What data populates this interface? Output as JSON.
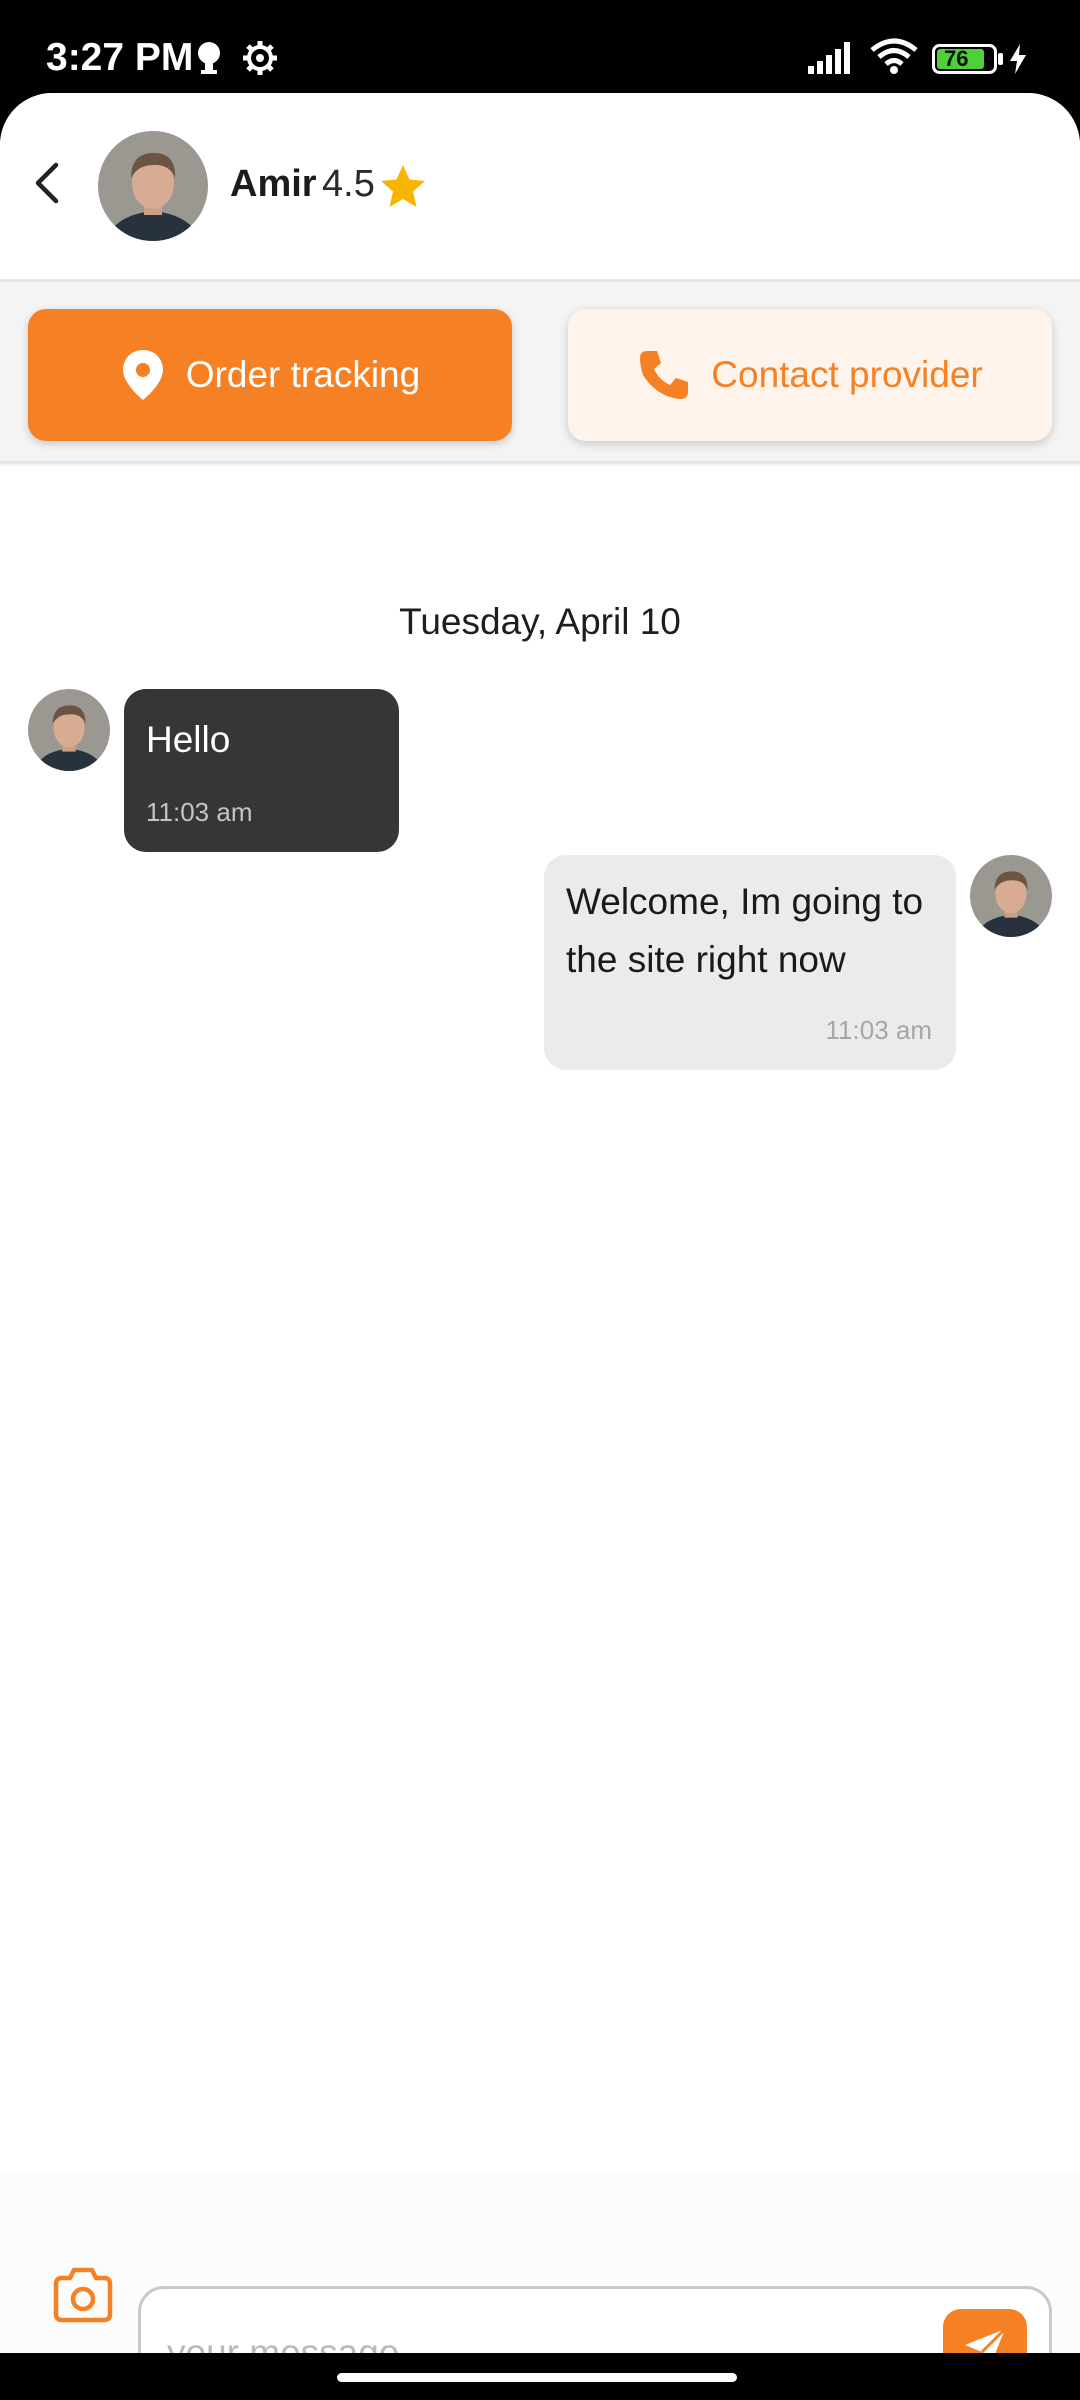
{
  "status_bar": {
    "time": "3:27 PM",
    "battery_level": "76",
    "icons": [
      "notification-icon",
      "settings-icon",
      "signal-icon",
      "wifi-icon",
      "battery-icon",
      "charging-icon"
    ]
  },
  "header": {
    "name": "Amir",
    "rating": "4.5",
    "icons": [
      "back-arrow-icon",
      "star-icon"
    ]
  },
  "actions": {
    "tracking_label": "Order tracking",
    "contact_label": "Contact provider",
    "icons": [
      "location-pin-icon",
      "phone-icon"
    ]
  },
  "chat": {
    "date": "Tuesday, April 10",
    "messages": [
      {
        "direction": "incoming",
        "text": "Hello",
        "time": "11:03 am"
      },
      {
        "direction": "outgoing",
        "text": "Welcome, Im going to the site right now",
        "time": "11:03 am"
      }
    ]
  },
  "composer": {
    "placeholder": "your message",
    "value": "",
    "icons": [
      "camera-icon",
      "send-icon"
    ]
  },
  "colors": {
    "accent": "#f68024",
    "incoming_bubble": "#363636",
    "outgoing_bubble": "#ebebeb",
    "star": "#f7b500",
    "battery": "#4cd137"
  }
}
